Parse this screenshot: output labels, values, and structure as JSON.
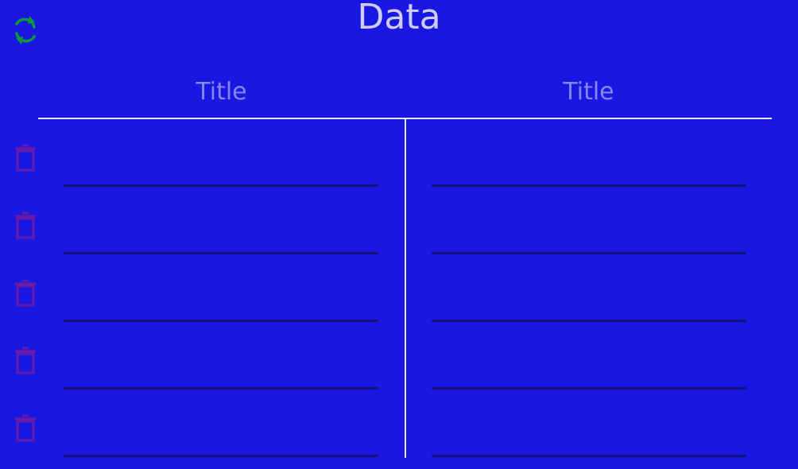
{
  "header": {
    "title": "Data",
    "refresh_icon": "refresh-icon"
  },
  "table": {
    "columns": [
      {
        "label": "Title"
      },
      {
        "label": "Title"
      }
    ],
    "rows": [
      {
        "left_value": "",
        "right_value": ""
      },
      {
        "left_value": "",
        "right_value": ""
      },
      {
        "left_value": "",
        "right_value": ""
      },
      {
        "left_value": "",
        "right_value": ""
      },
      {
        "left_value": "",
        "right_value": ""
      }
    ],
    "delete_icon": "trash-icon"
  },
  "colors": {
    "background": "#1a17e3",
    "title": "#cfcdf7",
    "column_header": "#8686f0",
    "refresh_icon": "#0a9a3c",
    "delete_icon": "#6a1aa8",
    "rule": "#e8e8fb",
    "field_underline": "#14127a"
  }
}
